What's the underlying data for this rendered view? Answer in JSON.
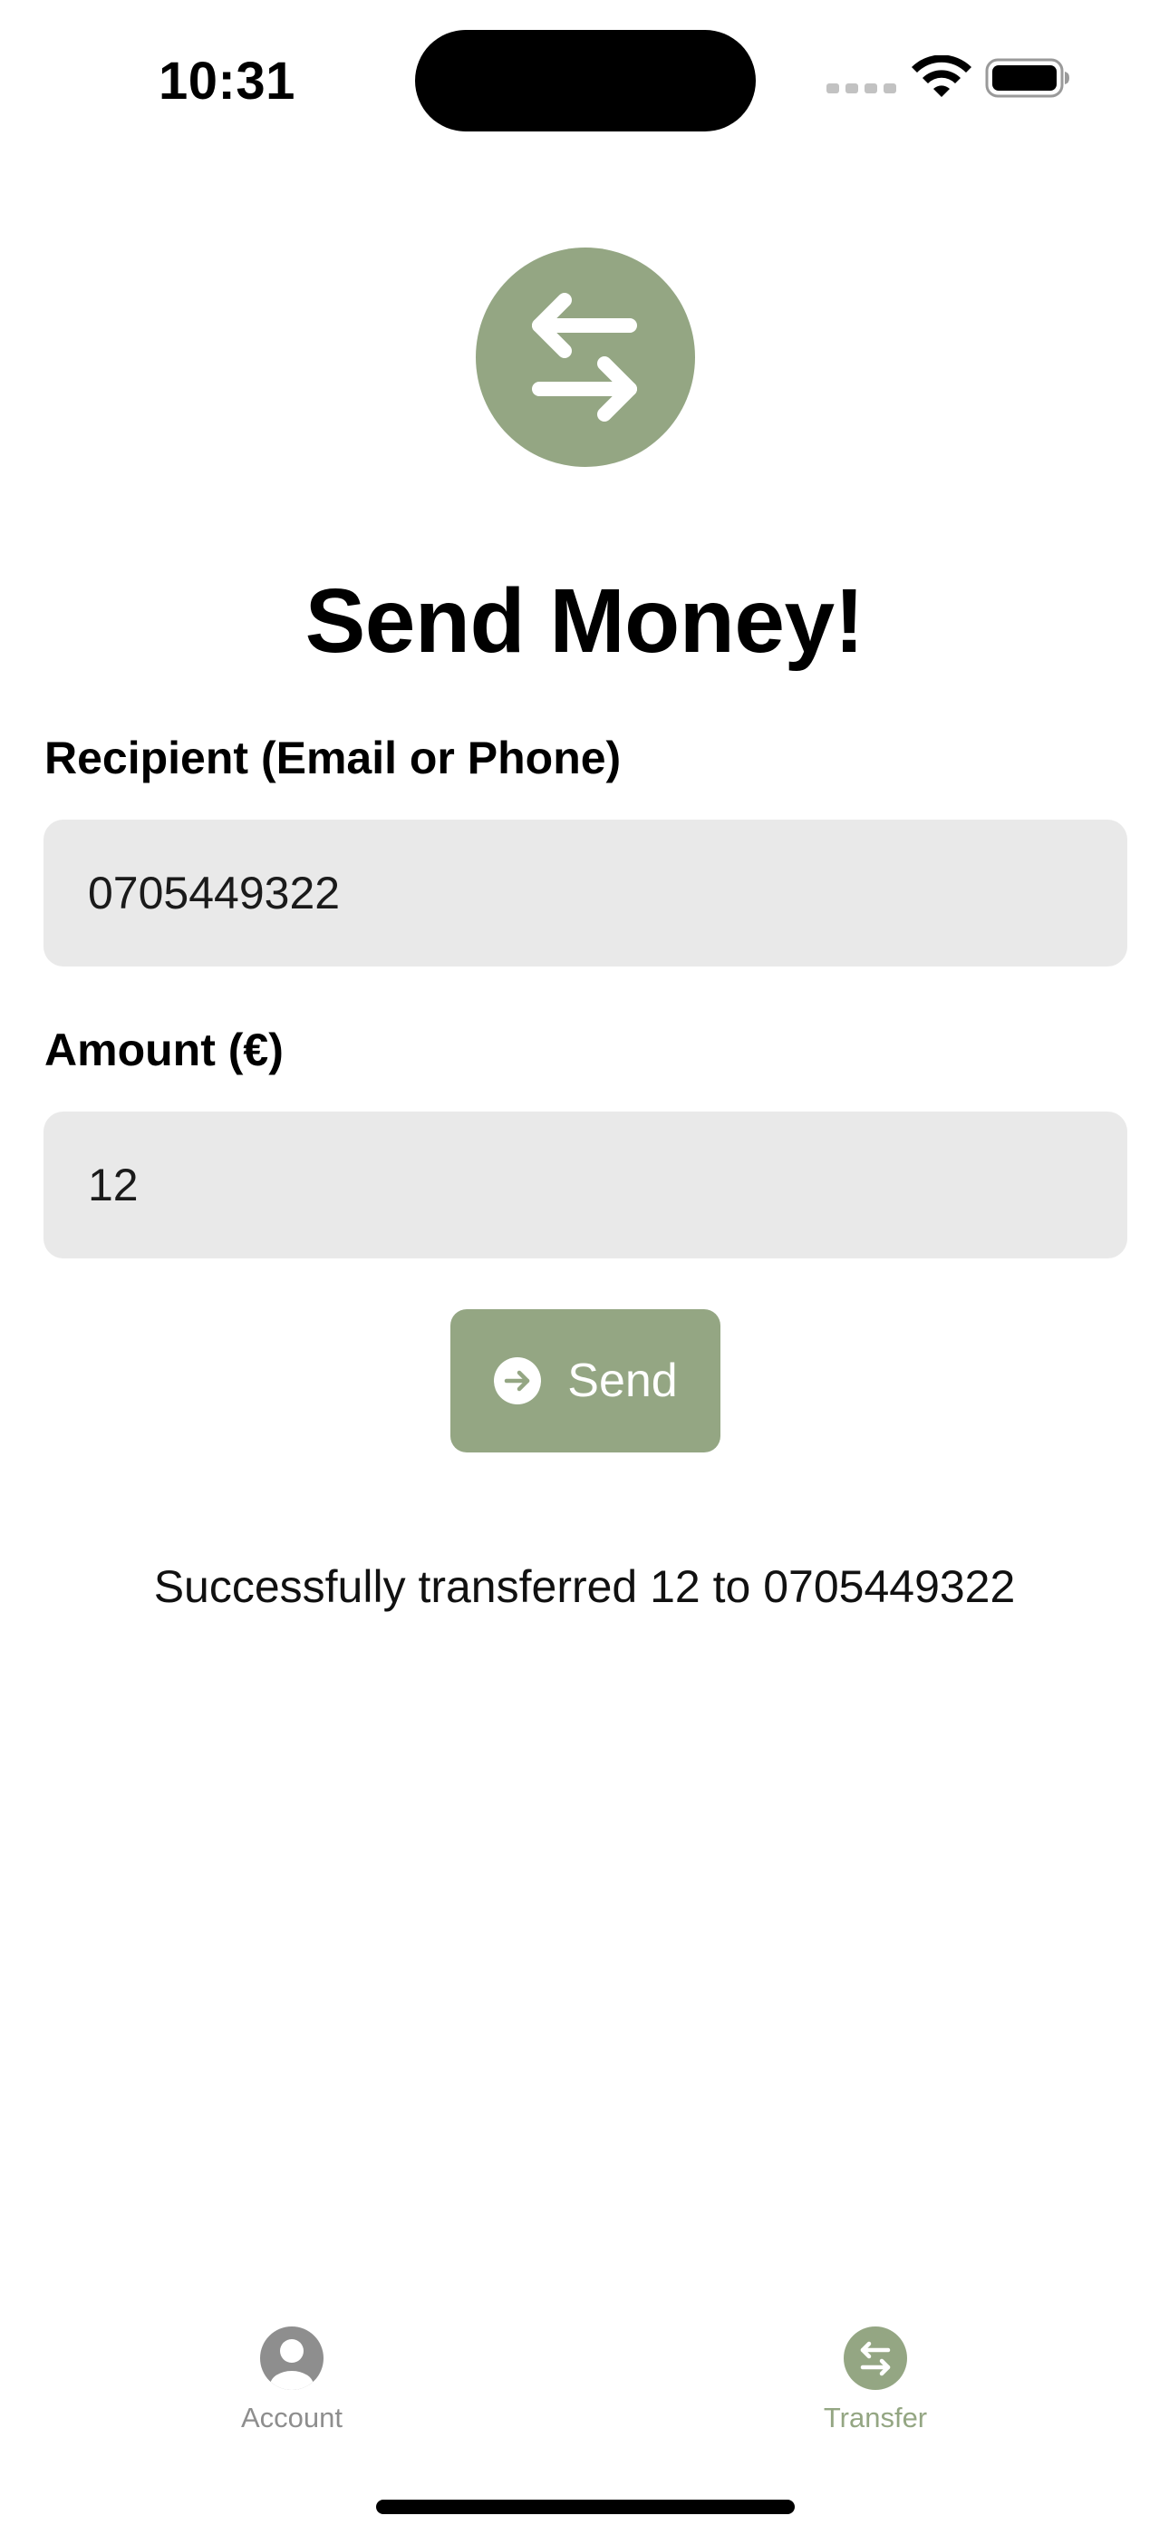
{
  "status_bar": {
    "time": "10:31",
    "icons": [
      "cellular-signal-icon",
      "wifi-icon",
      "battery-icon"
    ]
  },
  "colors": {
    "accent": "#94a683",
    "input_background": "#e9e9e9",
    "tab_inactive": "#8e8e8e"
  },
  "header": {
    "icon": "arrows-left-right-icon",
    "title": "Send Money!"
  },
  "form": {
    "recipient": {
      "label": "Recipient (Email or Phone)",
      "value": "0705449322"
    },
    "amount": {
      "label": "Amount (€)",
      "value": "12"
    },
    "send_button": {
      "label": "Send",
      "icon": "arrow-right-circle-icon"
    }
  },
  "status_message": "Successfully transferred 12 to 0705449322",
  "tab_bar": {
    "selected": "Transfer",
    "tabs": [
      {
        "label": "Account",
        "icon": "person-circle-icon"
      },
      {
        "label": "Transfer",
        "icon": "arrows-left-right-circle-icon"
      }
    ]
  }
}
